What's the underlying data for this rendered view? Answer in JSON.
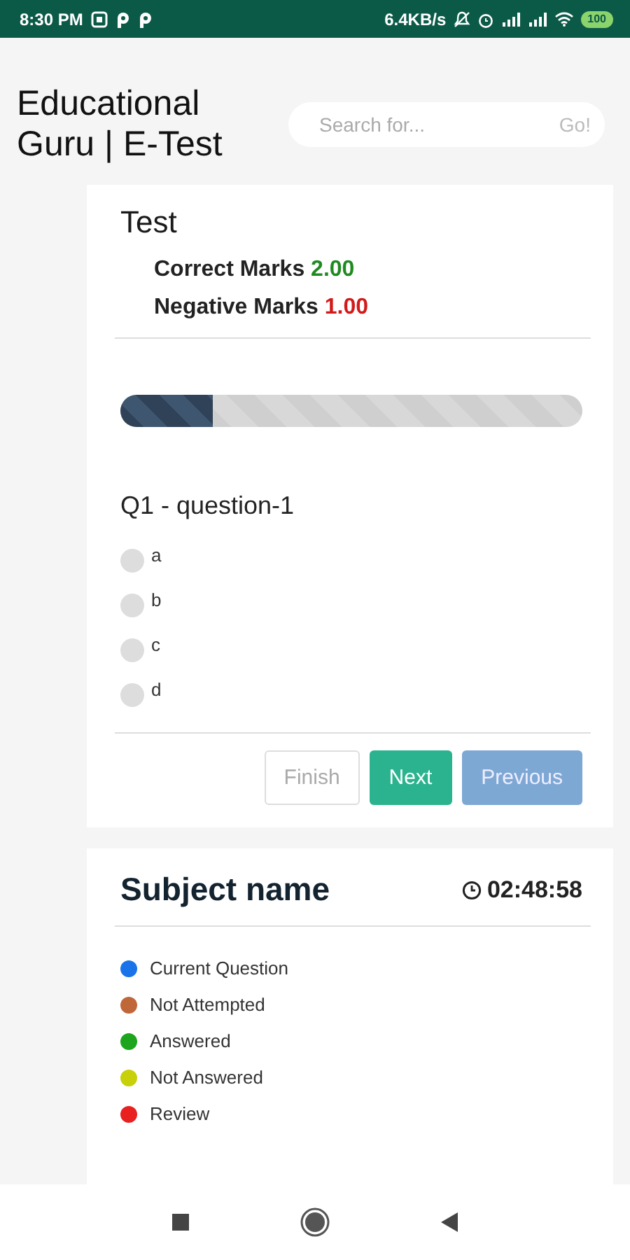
{
  "status_bar": {
    "time": "8:30 PM",
    "speed": "6.4KB/s",
    "battery": "100"
  },
  "header": {
    "title": "Educational Guru | E-Test",
    "search": {
      "placeholder": "Search for...",
      "button": "Go!"
    }
  },
  "test_card": {
    "title": "Test",
    "marks": [
      {
        "label": "Correct Marks",
        "value": "2.00",
        "kind": "positive"
      },
      {
        "label": "Negative Marks",
        "value": "1.00",
        "kind": "negative"
      }
    ],
    "progress": {
      "level": 0.2
    },
    "question": "Q1 - question-1",
    "options": [
      {
        "label": "a",
        "selected": false
      },
      {
        "label": "b",
        "selected": false
      },
      {
        "label": "c",
        "selected": false
      },
      {
        "label": "d",
        "selected": false
      }
    ],
    "buttons": [
      {
        "label": "Finish",
        "kind": "outline"
      },
      {
        "label": "Next",
        "kind": "primary"
      },
      {
        "label": "Previous",
        "kind": "muted"
      }
    ]
  },
  "subject_card": {
    "title": "Subject name",
    "timer": "02:48:58",
    "legend": [
      {
        "label": "Current Question",
        "color": "#1a73e8"
      },
      {
        "label": "Not Attempted",
        "color": "#c0673a"
      },
      {
        "label": "Answered",
        "color": "#1ea51e"
      },
      {
        "label": "Not Answered",
        "color": "#c8d00a"
      },
      {
        "label": "Review",
        "color": "#e82020"
      }
    ]
  }
}
